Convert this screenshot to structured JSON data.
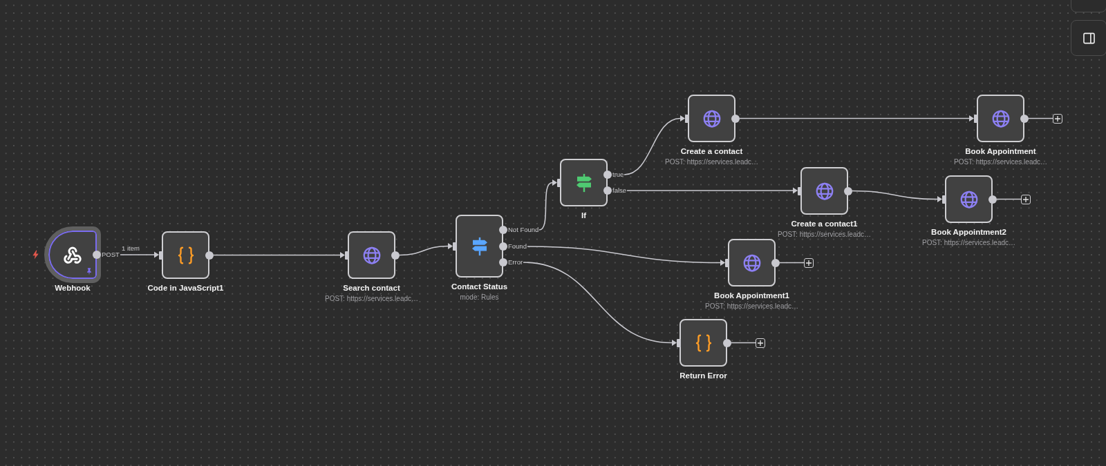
{
  "canvas": {
    "nodes": [
      {
        "title": "Webhook",
        "kind": "webhook",
        "trigger": true,
        "pinned": true,
        "selected": true,
        "outputs": [
          {
            "label": "POST",
            "items_label": "1 item",
            "add_button": false
          }
        ]
      },
      {
        "title": "Code in JavaScript1",
        "kind": "code",
        "trigger": false,
        "pinned": false,
        "selected": false,
        "outputs": [
          {
            "add_button": false
          }
        ]
      },
      {
        "title": "Search contact",
        "subtitle": "POST: https://services.leadc…",
        "kind": "http",
        "trigger": false,
        "pinned": false,
        "selected": false,
        "outputs": [
          {
            "add_button": false
          }
        ]
      },
      {
        "title": "Contact Status",
        "subtitle": "mode: Rules",
        "kind": "switch",
        "trigger": false,
        "pinned": false,
        "selected": false,
        "outputs": [
          {
            "label": "Not Found",
            "add_button": false
          },
          {
            "label": "Found",
            "add_button": false
          },
          {
            "label": "Error",
            "add_button": false
          }
        ]
      },
      {
        "title": "If",
        "kind": "if",
        "trigger": false,
        "pinned": false,
        "selected": false,
        "outputs": [
          {
            "label": "true",
            "add_button": false
          },
          {
            "label": "false",
            "add_button": false
          }
        ]
      },
      {
        "title": "Create a contact",
        "subtitle": "POST: https://services.leadc…",
        "kind": "http",
        "trigger": false,
        "pinned": false,
        "selected": false,
        "outputs": [
          {
            "add_button": false
          }
        ]
      },
      {
        "title": "Book Appointment",
        "subtitle": "POST: https://services.leadc…",
        "kind": "http",
        "trigger": false,
        "pinned": false,
        "selected": false,
        "outputs": [
          {
            "add_button": true
          }
        ]
      },
      {
        "title": "Create a contact1",
        "subtitle": "POST: https://services.leadc…",
        "kind": "http",
        "trigger": false,
        "pinned": false,
        "selected": false,
        "outputs": [
          {
            "add_button": false
          }
        ]
      },
      {
        "title": "Book Appointment2",
        "subtitle": "POST: https://services.leadc…",
        "kind": "http",
        "trigger": false,
        "pinned": false,
        "selected": false,
        "outputs": [
          {
            "add_button": true
          }
        ]
      },
      {
        "title": "Book Appointment1",
        "subtitle": "POST: https://services.leadc…",
        "kind": "http",
        "trigger": false,
        "pinned": false,
        "selected": false,
        "outputs": [
          {
            "add_button": true
          }
        ]
      },
      {
        "title": "Return Error",
        "kind": "code",
        "trigger": false,
        "pinned": false,
        "selected": false,
        "outputs": [
          {
            "add_button": true
          }
        ]
      }
    ]
  }
}
